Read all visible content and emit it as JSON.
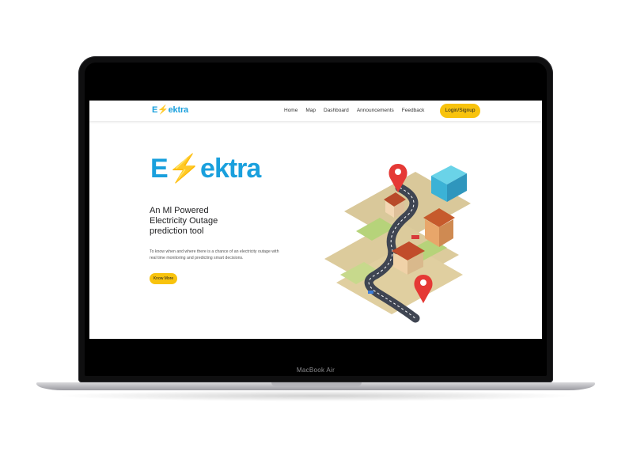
{
  "device": {
    "model_label": "MacBook Air"
  },
  "navbar": {
    "logo": {
      "e": "E",
      "bolt": "⚡",
      "rest": "ektra"
    },
    "links": [
      {
        "label": "Home"
      },
      {
        "label": "Map"
      },
      {
        "label": "Dashboard"
      },
      {
        "label": "Announcements"
      },
      {
        "label": "Feedback"
      }
    ],
    "login_label": "Login/Signup"
  },
  "hero": {
    "logo": {
      "e": "E",
      "bolt": "⚡",
      "rest": "ektra"
    },
    "title_lines": [
      "An Ml Powered",
      "Electricity Outage",
      "prediction tool"
    ],
    "description_lines": [
      "To know when and where there is a chance of an electricity outage with",
      "real time monitoring and predicting smart decisions."
    ],
    "cta_label": "Know More"
  },
  "colors": {
    "brand_blue": "#1aa0dd",
    "brand_yellow": "#f8c30d",
    "pin_red": "#e53935"
  },
  "illustration": {
    "icons": [
      "map-pin-icon",
      "house-icon",
      "building-icon"
    ]
  }
}
